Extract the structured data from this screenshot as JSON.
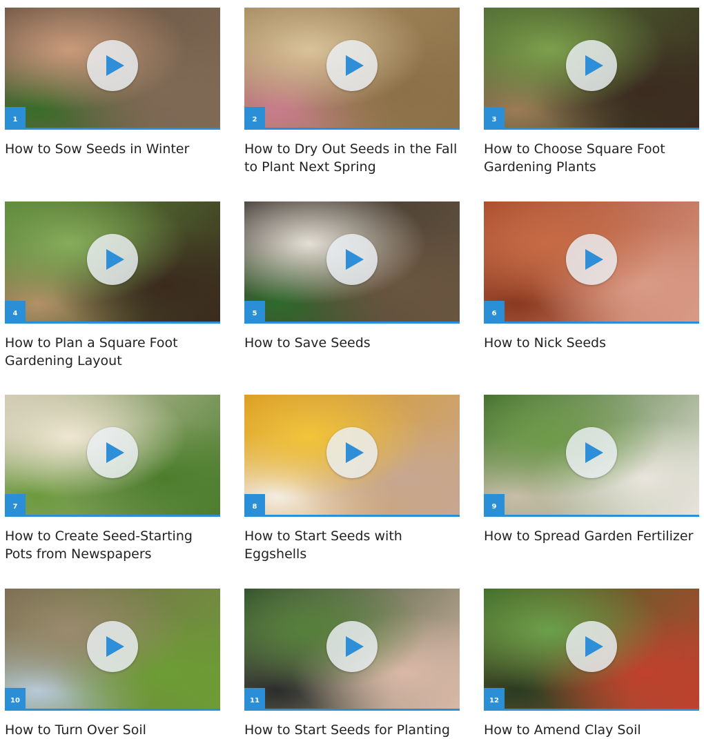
{
  "videos": [
    {
      "number": "1",
      "title": "How to Sow Seeds in Winter",
      "thumb_colors": [
        "#6b5443",
        "#c99b7b",
        "#7e6a55",
        "#3a6d2a"
      ]
    },
    {
      "number": "2",
      "title": "How to Dry Out Seeds in the Fall to Plant Next Spring",
      "thumb_colors": [
        "#a58a5e",
        "#d9c29a",
        "#8c7148",
        "#c87c8c"
      ]
    },
    {
      "number": "3",
      "title": "How to Choose Square Foot Gardening Plants",
      "thumb_colors": [
        "#4f6b33",
        "#7da04c",
        "#3b2b20",
        "#9c7b58"
      ]
    },
    {
      "number": "4",
      "title": "How to Plan a Square Foot Gardening Layout",
      "thumb_colors": [
        "#5b8a38",
        "#86ad5b",
        "#3a2a1e",
        "#b39068"
      ]
    },
    {
      "number": "5",
      "title": "How to Save Seeds",
      "thumb_colors": [
        "#3a3530",
        "#e4e0d6",
        "#6a5640",
        "#2f6a2b"
      ]
    },
    {
      "number": "6",
      "title": "How to Nick Seeds",
      "thumb_colors": [
        "#a84a2a",
        "#c66a44",
        "#d89a86",
        "#8a3a20"
      ]
    },
    {
      "number": "7",
      "title": "How to Create Seed-Starting Pots from Newspapers",
      "thumb_colors": [
        "#cfc7b2",
        "#efe6d2",
        "#4c7d2c",
        "#6c9a3d"
      ]
    },
    {
      "number": "8",
      "title": "How to Start Seeds with Eggshells",
      "thumb_colors": [
        "#d99a1e",
        "#f1c43a",
        "#c7a792",
        "#f4ece2"
      ]
    },
    {
      "number": "9",
      "title": "How to Spread Garden Fertilizer",
      "thumb_colors": [
        "#3f6b2a",
        "#6e9a48",
        "#e8e4dc",
        "#c8bda8"
      ]
    },
    {
      "number": "10",
      "title": "How to Turn Over Soil",
      "thumb_colors": [
        "#7a6a52",
        "#9a8a6e",
        "#6d9c35",
        "#b7c9d8"
      ]
    },
    {
      "number": "11",
      "title": "How to Start Seeds for Planting",
      "thumb_colors": [
        "#2e4e2a",
        "#56803a",
        "#d9b8a8",
        "#2c2c2c"
      ]
    },
    {
      "number": "12",
      "title": "How to Amend Clay Soil",
      "thumb_colors": [
        "#3b6b2a",
        "#6aa04a",
        "#c0412e",
        "#2a3b22"
      ]
    }
  ]
}
